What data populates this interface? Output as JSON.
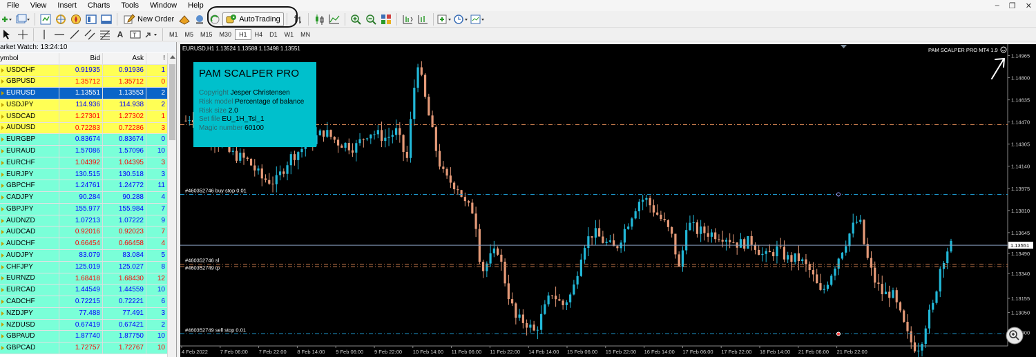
{
  "menu": {
    "items": [
      "File",
      "View",
      "Insert",
      "Charts",
      "Tools",
      "Window",
      "Help"
    ]
  },
  "toolbar": {
    "new_order_label": "New Order",
    "autotrading_label": "AutoTrading",
    "timeframes": [
      "M1",
      "M5",
      "M15",
      "M30",
      "H1",
      "H4",
      "D1",
      "W1",
      "MN"
    ],
    "active_timeframe": "H1"
  },
  "market_watch": {
    "title": "arket Watch: 13:24:10",
    "columns": [
      "ymbol",
      "Bid",
      "Ask",
      "!"
    ],
    "rows": [
      {
        "symbol": "USDCHF",
        "bid": "0.91935",
        "ask": "0.91936",
        "spread": "1",
        "bg": "yellow",
        "dir": "up"
      },
      {
        "symbol": "GBPUSD",
        "bid": "1.35712",
        "ask": "1.35712",
        "spread": "0",
        "bg": "yellow",
        "dir": "down"
      },
      {
        "symbol": "EURUSD",
        "bid": "1.13551",
        "ask": "1.13553",
        "spread": "2",
        "bg": "selected",
        "dir": "up"
      },
      {
        "symbol": "USDJPY",
        "bid": "114.936",
        "ask": "114.938",
        "spread": "2",
        "bg": "yellow",
        "dir": "up"
      },
      {
        "symbol": "USDCAD",
        "bid": "1.27301",
        "ask": "1.27302",
        "spread": "1",
        "bg": "yellow",
        "dir": "down"
      },
      {
        "symbol": "AUDUSD",
        "bid": "0.72283",
        "ask": "0.72286",
        "spread": "3",
        "bg": "yellow",
        "dir": "down"
      },
      {
        "symbol": "EURGBP",
        "bid": "0.83674",
        "ask": "0.83674",
        "spread": "0",
        "bg": "cyan",
        "dir": "up"
      },
      {
        "symbol": "EURAUD",
        "bid": "1.57086",
        "ask": "1.57096",
        "spread": "10",
        "bg": "cyan",
        "dir": "up"
      },
      {
        "symbol": "EURCHF",
        "bid": "1.04392",
        "ask": "1.04395",
        "spread": "3",
        "bg": "cyan",
        "dir": "down"
      },
      {
        "symbol": "EURJPY",
        "bid": "130.515",
        "ask": "130.518",
        "spread": "3",
        "bg": "cyan",
        "dir": "up"
      },
      {
        "symbol": "GBPCHF",
        "bid": "1.24761",
        "ask": "1.24772",
        "spread": "11",
        "bg": "cyan",
        "dir": "up"
      },
      {
        "symbol": "CADJPY",
        "bid": "90.284",
        "ask": "90.288",
        "spread": "4",
        "bg": "cyan",
        "dir": "up"
      },
      {
        "symbol": "GBPJPY",
        "bid": "155.977",
        "ask": "155.984",
        "spread": "7",
        "bg": "cyan",
        "dir": "up"
      },
      {
        "symbol": "AUDNZD",
        "bid": "1.07213",
        "ask": "1.07222",
        "spread": "9",
        "bg": "cyan",
        "dir": "up"
      },
      {
        "symbol": "AUDCAD",
        "bid": "0.92016",
        "ask": "0.92023",
        "spread": "7",
        "bg": "cyan",
        "dir": "down"
      },
      {
        "symbol": "AUDCHF",
        "bid": "0.66454",
        "ask": "0.66458",
        "spread": "4",
        "bg": "cyan",
        "dir": "down"
      },
      {
        "symbol": "AUDJPY",
        "bid": "83.079",
        "ask": "83.084",
        "spread": "5",
        "bg": "cyan",
        "dir": "up"
      },
      {
        "symbol": "CHFJPY",
        "bid": "125.019",
        "ask": "125.027",
        "spread": "8",
        "bg": "cyan",
        "dir": "up"
      },
      {
        "symbol": "EURNZD",
        "bid": "1.68418",
        "ask": "1.68430",
        "spread": "12",
        "bg": "cyan",
        "dir": "down"
      },
      {
        "symbol": "EURCAD",
        "bid": "1.44549",
        "ask": "1.44559",
        "spread": "10",
        "bg": "cyan",
        "dir": "up"
      },
      {
        "symbol": "CADCHF",
        "bid": "0.72215",
        "ask": "0.72221",
        "spread": "6",
        "bg": "cyan",
        "dir": "up"
      },
      {
        "symbol": "NZDJPY",
        "bid": "77.488",
        "ask": "77.491",
        "spread": "3",
        "bg": "cyan",
        "dir": "up"
      },
      {
        "symbol": "NZDUSD",
        "bid": "0.67419",
        "ask": "0.67421",
        "spread": "2",
        "bg": "cyan",
        "dir": "up"
      },
      {
        "symbol": "GBPAUD",
        "bid": "1.87740",
        "ask": "1.87750",
        "spread": "10",
        "bg": "cyan",
        "dir": "up"
      },
      {
        "symbol": "GBPCAD",
        "bid": "1.72757",
        "ask": "1.72767",
        "spread": "10",
        "bg": "cyan",
        "dir": "down"
      }
    ]
  },
  "chart": {
    "title": "EURUSD,H1  1.13524 1.13588 1.13498 1.13551",
    "ea_label": "PAM SCALPER PRO MT4 1.9",
    "price_labels": [
      "1.14965",
      "1.14800",
      "1.14635",
      "1.14470",
      "1.14305",
      "1.14140",
      "1.13975",
      "1.13810",
      "1.13645",
      "1.13490",
      "1.13340",
      "1.13155",
      "1.13050",
      "1.12900"
    ],
    "current_price": "1.13551",
    "time_labels": [
      "4 Feb 2022",
      "7 Feb 06:00",
      "7 Feb 22:00",
      "8 Feb 14:00",
      "9 Feb 06:00",
      "9 Feb 22:00",
      "10 Feb 14:00",
      "11 Feb 06:00",
      "11 Feb 22:00",
      "14 Feb 14:00",
      "15 Feb 06:00",
      "15 Feb 22:00",
      "16 Feb 14:00",
      "17 Feb 06:00",
      "17 Feb 22:00",
      "18 Feb 14:00",
      "21 Feb 06:00",
      "21 Feb 22:00"
    ],
    "order_lines": [
      {
        "label": "#460352746 buy stop 0.01",
        "price": 1.1393,
        "color": "#1e9ed6"
      },
      {
        "label": "#460352746 sl",
        "price": 1.1341,
        "color": "#d08050"
      },
      {
        "label": "#460352749 tp",
        "price": 1.1339,
        "color": "#d08050"
      },
      {
        "label": "#460352749 sell stop 0.01",
        "price": 1.1289,
        "color": "#1e9ed6"
      },
      {
        "label": "",
        "price": 1.1445,
        "color": "#d08050"
      }
    ],
    "colors": {
      "bull": "#22b8d8",
      "bear": "#e59a78",
      "background": "#000000",
      "grid": "#ffffff"
    }
  },
  "info_panel": {
    "title": "PAM SCALPER PRO",
    "rows": [
      {
        "label": "Copyright",
        "value": "Jesper Christensen"
      },
      {
        "label": "Risk model",
        "value": "Percentage of balance"
      },
      {
        "label": "Risk size",
        "value": "2.0"
      },
      {
        "label": "Set file",
        "value": "EU_1H_Tsl_1"
      },
      {
        "label": "Magic number",
        "value": "60100"
      }
    ],
    "bg_color": "#00c0cc"
  }
}
